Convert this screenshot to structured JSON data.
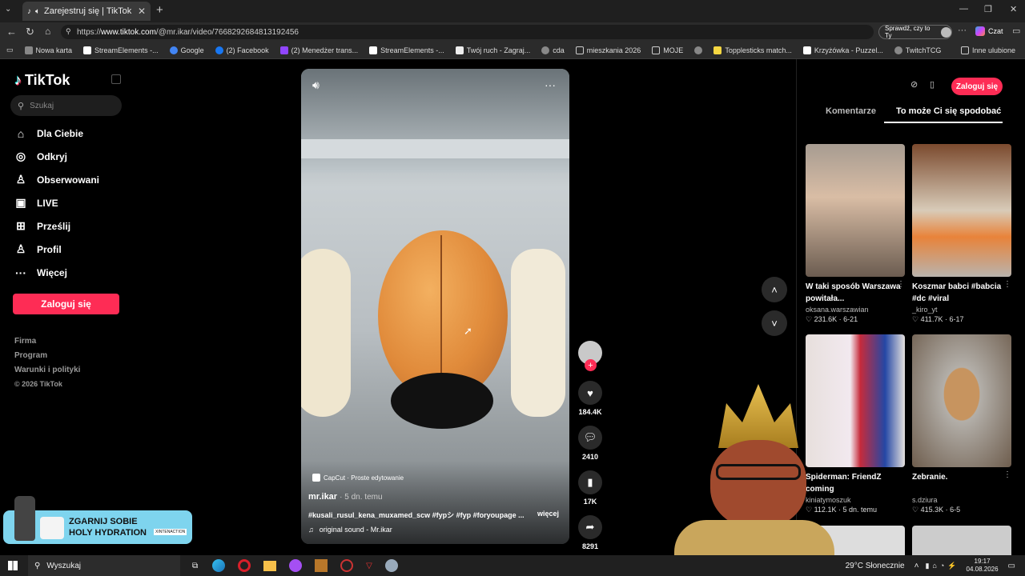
{
  "browser": {
    "tab_title": "Zarejestruj się | TikTok",
    "url_prefix": "https://",
    "url_host": "www.tiktok.com",
    "url_path": "/@mr.ikar/video/7668292684813192456",
    "check_label": "Sprawdź, czy to Ty",
    "chat_label": "Czat",
    "bookmarks": [
      "Nowa karta",
      "StreamElements -...",
      "Google",
      "(2) Facebook",
      "(2) Menedżer trans...",
      "StreamElements -...",
      "Twój ruch - Zagraj...",
      "cda",
      "mieszkania 2026",
      "MOJE",
      "",
      "Topplesticks match...",
      "Krzyżówka - Puzzel...",
      "TwitchTCG"
    ],
    "other_bookmarks": "Inne ulubione"
  },
  "sidebar": {
    "logo": "TikTok",
    "search_placeholder": "Szukaj",
    "nav": [
      {
        "label": "Dla Ciebie",
        "icon": "home-icon"
      },
      {
        "label": "Odkryj",
        "icon": "compass-icon"
      },
      {
        "label": "Obserwowani",
        "icon": "following-icon"
      },
      {
        "label": "LIVE",
        "icon": "live-icon"
      },
      {
        "label": "Prześlij",
        "icon": "upload-icon"
      },
      {
        "label": "Profil",
        "icon": "profile-icon"
      },
      {
        "label": "Więcej",
        "icon": "more-icon"
      }
    ],
    "login_label": "Zaloguj się",
    "footer": [
      "Firma",
      "Program",
      "Warunki i polityki"
    ],
    "copyright": "© 2026 TikTok"
  },
  "video": {
    "capcut": "CapCut · Proste edytowanie",
    "author": "mr.ikar",
    "age": "· 5 dn. temu",
    "caption": "#kusali_rusul_kena_muxamed_scw #fypシ #fyp #foryoupage ...",
    "more": "więcej",
    "sound": "original sound - Mr.ikar",
    "likes": "184.4K",
    "comments": "2410",
    "saves": "17K",
    "shares": "8291"
  },
  "panel": {
    "login_label": "Zaloguj się",
    "tab_comments": "Komentarze",
    "tab_recommend": "To może Ci się spodobać",
    "cards": [
      {
        "title": "W taki sposób Warszawa powitała...",
        "user": "oksana.warszawian",
        "likes": "231.6K",
        "date": "6-21"
      },
      {
        "title": "Koszmar babci #babcia #dc #viral",
        "user": "_kiro_yt",
        "likes": "411.7K",
        "date": "6-17"
      },
      {
        "title": "Spiderman: FriendZ coming",
        "user": "kiniatymoszuk",
        "likes": "112.1K",
        "date": "5 dn. temu"
      },
      {
        "title": "Zebranie.",
        "user": "s.dziura",
        "likes": "415.3K",
        "date": "6-5"
      }
    ]
  },
  "ad": {
    "line1": "ZGARNIJ SOBIE",
    "line2": "HOLY HYDRATION",
    "tag": "XINTENACTION"
  },
  "taskbar": {
    "search": "Wyszukaj",
    "weather": "29°C Słonecznie",
    "time": "19:17",
    "date": "04.08.2026"
  }
}
